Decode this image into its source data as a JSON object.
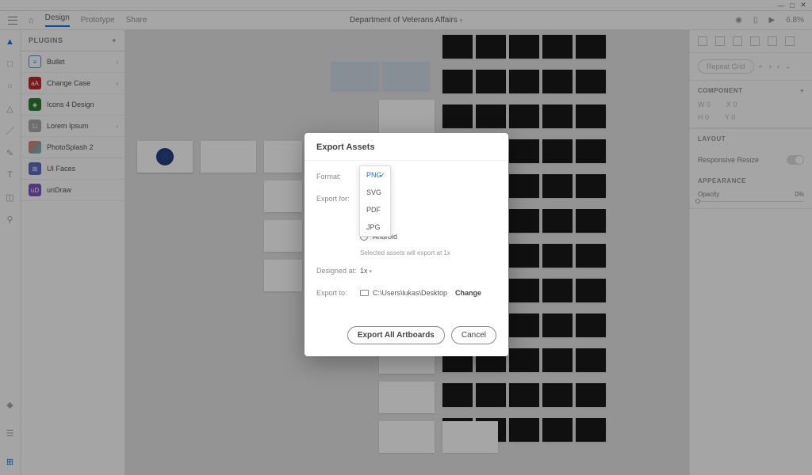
{
  "titlebar": {
    "min": "—",
    "max": "□",
    "close": "✕"
  },
  "topbar": {
    "tabs": [
      "Design",
      "Prototype",
      "Share"
    ],
    "title": "Department of Veterans Affairs",
    "zoom": "6.8%"
  },
  "plugins": {
    "header": "PLUGINS",
    "items": [
      {
        "label": "Bullet",
        "color": "#fff",
        "border": "#4a90e2"
      },
      {
        "label": "Change Case",
        "color": "#c1272d"
      },
      {
        "label": "Icons 4 Design",
        "color": "#2e7d32"
      },
      {
        "label": "Lorem Ipsum",
        "color": "#aaa"
      },
      {
        "label": "PhotoSplash 2",
        "color": "#333"
      },
      {
        "label": "UI Faces",
        "color": "#5c6bc0"
      },
      {
        "label": "unDraw",
        "color": "#7e57c2"
      }
    ]
  },
  "rightpanel": {
    "repeat": "Repeat Grid",
    "component_hdr": "COMPONENT",
    "w": "W  0",
    "h": "H  0",
    "x": "X  0",
    "y": "Y  0",
    "layout_hdr": "LAYOUT",
    "resp": "Responsive Resize",
    "appear_hdr": "APPEARANCE",
    "opacity": "Opacity",
    "opval": "0%"
  },
  "modal": {
    "title": "Export Assets",
    "format_lbl": "Format:",
    "exportfor_lbl": "Export for:",
    "android": "Android",
    "note": "Selected assets will export at 1x",
    "designed_lbl": "Designed at:",
    "designed_val": "1x",
    "exportto_lbl": "Export to:",
    "path": "C:\\Users\\lukas\\Desktop",
    "change": "Change",
    "primary": "Export All Artboards",
    "cancel": "Cancel"
  },
  "dropdown": {
    "options": [
      "PNG",
      "SVG",
      "PDF",
      "JPG"
    ],
    "selected": "PNG"
  }
}
